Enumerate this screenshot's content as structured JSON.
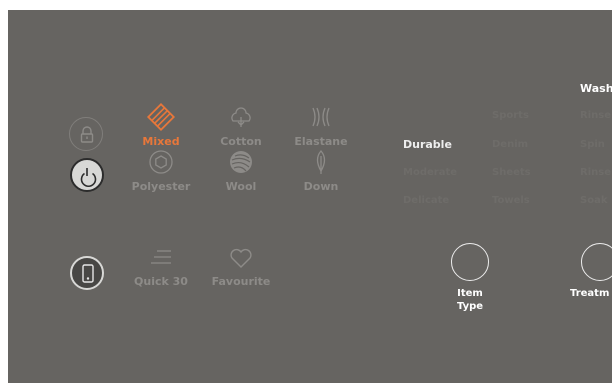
{
  "programs": [
    {
      "name": "mixed-program",
      "label": "Mixed",
      "icon": "mixed-icon",
      "selected": true
    },
    {
      "name": "cotton-program",
      "label": "Cotton",
      "icon": "cotton-icon",
      "selected": false
    },
    {
      "name": "elastane-program",
      "label": "Elastane",
      "icon": "elastane-icon",
      "selected": false
    },
    {
      "name": "polyester-program",
      "label": "Polyester",
      "icon": "polyester-icon",
      "selected": false
    },
    {
      "name": "wool-program",
      "label": "Wool",
      "icon": "wool-icon",
      "selected": false
    },
    {
      "name": "down-program",
      "label": "Down",
      "icon": "down-icon",
      "selected": false
    },
    {
      "name": "quick30-program",
      "label": "Quick 30",
      "icon": "quick-icon",
      "selected": false
    },
    {
      "name": "favourite-program",
      "label": "Favourite",
      "icon": "heart-icon",
      "selected": false
    }
  ],
  "item_types": {
    "col1": [
      "Durable",
      "Moderate",
      "Delicate"
    ],
    "col2": [
      "Sports",
      "Denim",
      "Sheets",
      "Towels"
    ],
    "col3": [
      "Rinse",
      "Spin",
      "Rinse",
      "Soak"
    ],
    "active": "Durable"
  },
  "wash_menu": {
    "title": "Wash"
  },
  "buttons": {
    "item_type": {
      "line1": "Item",
      "line2": "Type"
    },
    "treatment": {
      "label": "Treatm"
    }
  },
  "colors": {
    "panel": "#666461",
    "accent": "#e8773a",
    "dim_text": "#8d8b88",
    "active_text": "#eeeeee"
  }
}
